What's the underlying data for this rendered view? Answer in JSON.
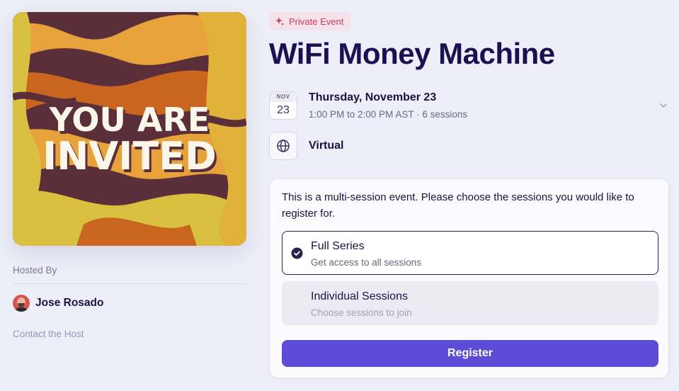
{
  "cover": {
    "line1": "YOU ARE",
    "line2": "INVITED"
  },
  "host": {
    "label": "Hosted By",
    "name": "Jose Rosado",
    "contact_label": "Contact the Host"
  },
  "event": {
    "badge": "Private Event",
    "title": "WiFi Money Machine",
    "date_tile": {
      "month": "NOV",
      "day": "23"
    },
    "date_main": "Thursday, November 23",
    "date_sub": "1:00 PM to 2:00 PM AST · 6 sessions",
    "location": "Virtual"
  },
  "registration": {
    "intro": "This is a multi-session event. Please choose the sessions you would like to register for.",
    "options": [
      {
        "title": "Full Series",
        "subtitle": "Get access to all sessions",
        "selected": true
      },
      {
        "title": "Individual Sessions",
        "subtitle": "Choose sessions to join",
        "selected": false
      }
    ],
    "register_label": "Register"
  },
  "colors": {
    "accent": "#5c4cd6",
    "badge_text": "#d03a5d",
    "badge_bg": "#f6e2ea",
    "title": "#1c1150",
    "background": "#eeeef8"
  },
  "icons": {
    "badge": "sparkle-icon",
    "location": "globe-icon",
    "expand": "chevron-down-icon",
    "selected": "check-circle-icon"
  }
}
